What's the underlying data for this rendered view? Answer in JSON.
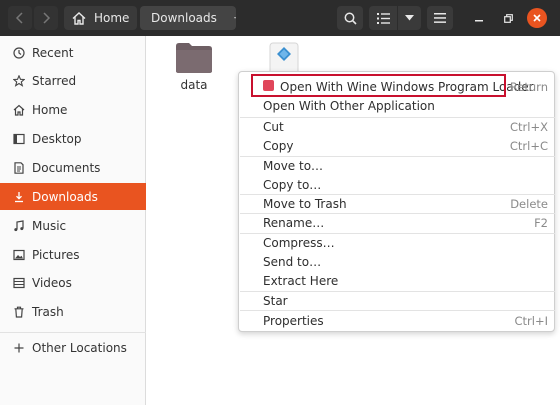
{
  "window": {
    "breadcrumb": {
      "home_label": "Home",
      "current_label": "Downloads"
    }
  },
  "sidebar": {
    "items": [
      {
        "label": "Recent",
        "icon": "clock-icon"
      },
      {
        "label": "Starred",
        "icon": "star-icon"
      },
      {
        "label": "Home",
        "icon": "home-icon"
      },
      {
        "label": "Desktop",
        "icon": "desktop-icon"
      },
      {
        "label": "Documents",
        "icon": "document-icon"
      },
      {
        "label": "Downloads",
        "icon": "download-icon",
        "active": true
      },
      {
        "label": "Music",
        "icon": "music-icon"
      },
      {
        "label": "Pictures",
        "icon": "picture-icon"
      },
      {
        "label": "Videos",
        "icon": "video-icon"
      },
      {
        "label": "Trash",
        "icon": "trash-icon"
      }
    ],
    "other_locations": {
      "label": "Other Locations",
      "icon": "plus-icon"
    }
  },
  "files": [
    {
      "name": "data",
      "type": "folder"
    },
    {
      "name": "",
      "type": "installer"
    }
  ],
  "context_menu": {
    "items": [
      {
        "label": "Open With Wine Windows Program Loader",
        "accel": "Return",
        "highlighted": true
      },
      {
        "label": "Open With Other Application",
        "accel": ""
      },
      {
        "label": "Cut",
        "accel": "Ctrl+X"
      },
      {
        "label": "Copy",
        "accel": "Ctrl+C"
      },
      {
        "label": "Move to…",
        "accel": ""
      },
      {
        "label": "Copy to…",
        "accel": ""
      },
      {
        "label": "Move to Trash",
        "accel": "Delete"
      },
      {
        "label": "Rename…",
        "accel": "F2"
      },
      {
        "label": "Compress…",
        "accel": ""
      },
      {
        "label": "Send to…",
        "accel": ""
      },
      {
        "label": "Extract Here",
        "accel": ""
      },
      {
        "label": "Star",
        "accel": ""
      },
      {
        "label": "Properties",
        "accel": "Ctrl+I"
      }
    ]
  },
  "colors": {
    "accent": "#e95420",
    "highlight_border": "#c8102e",
    "header_bg": "#2c2c2c",
    "folder": "#6e5f64"
  }
}
